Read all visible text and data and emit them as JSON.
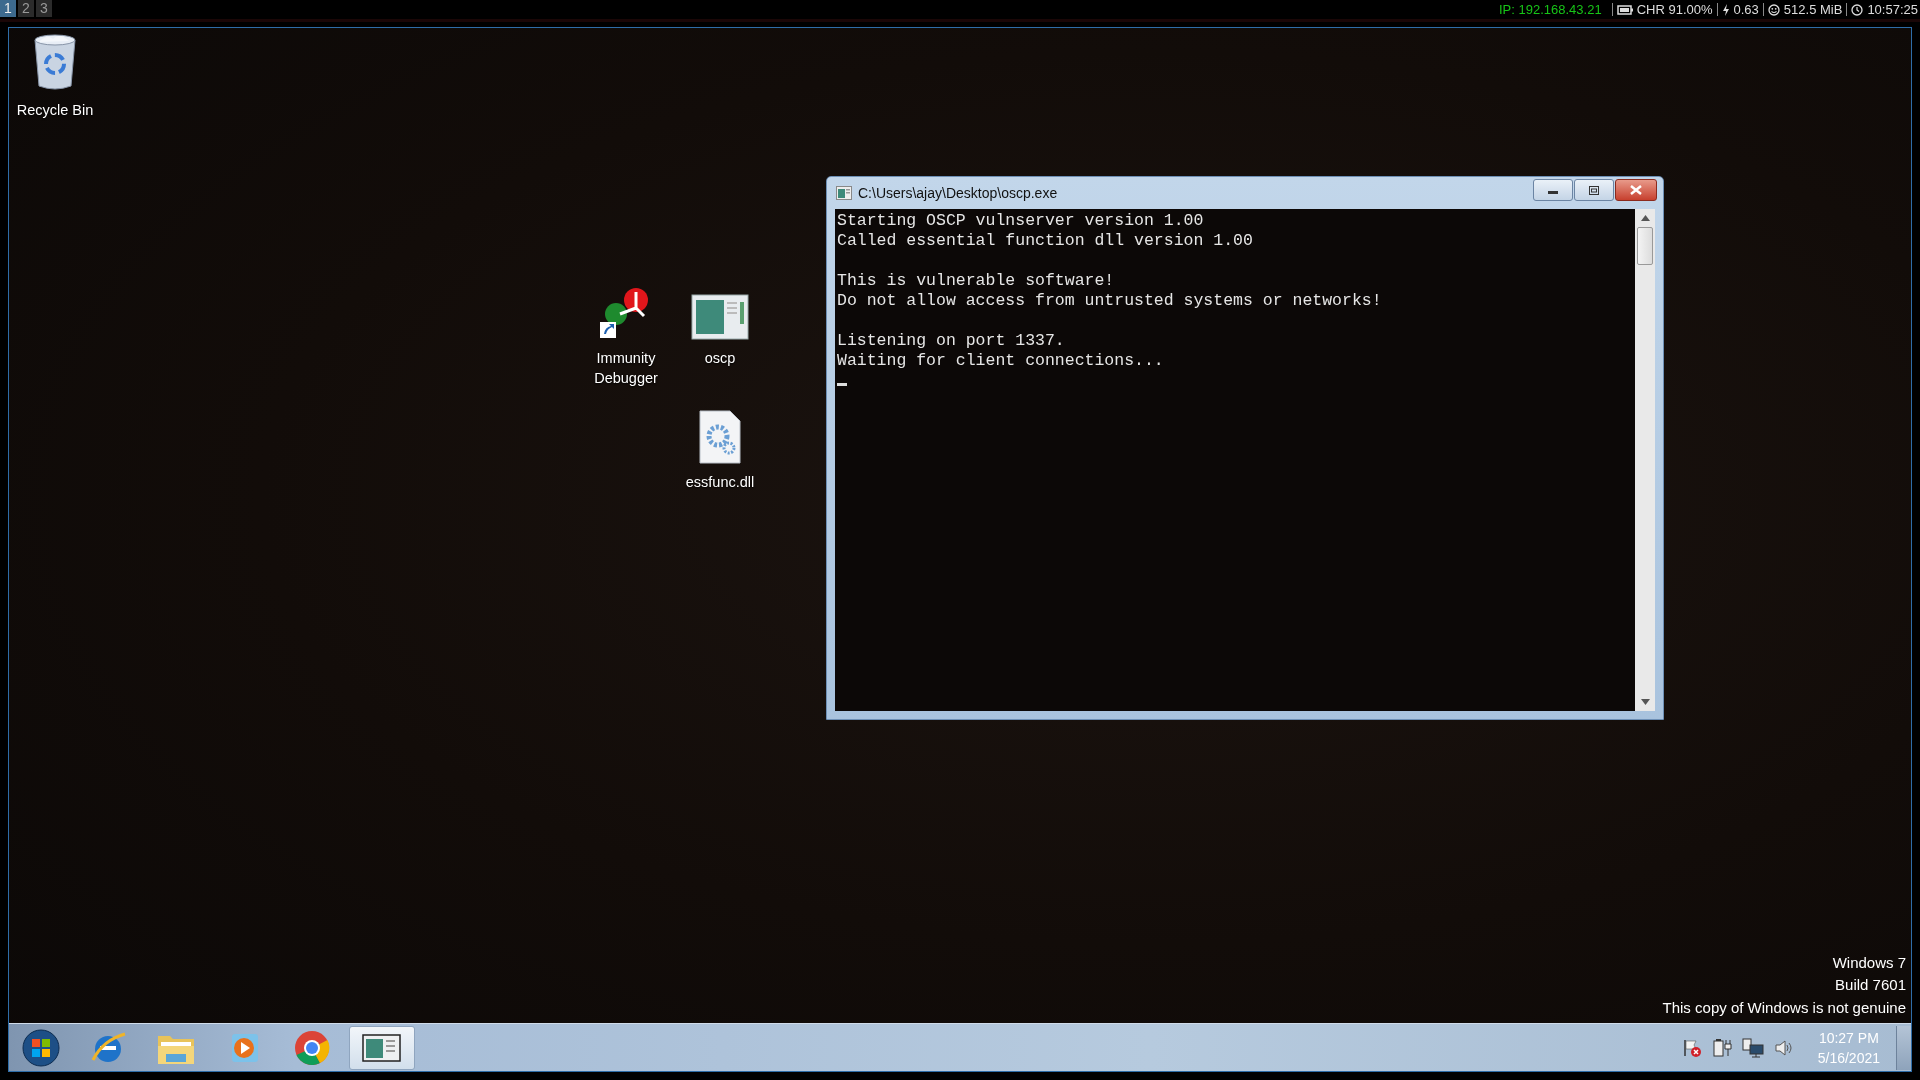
{
  "top_bar": {
    "workspaces": [
      {
        "label": "1",
        "selected": true
      },
      {
        "label": "2",
        "selected": false
      },
      {
        "label": "3",
        "selected": false
      }
    ],
    "ip": "IP: 192.168.43.21",
    "battery": "CHR 91.00%",
    "load": "0.63",
    "memory": "512.5 MiB",
    "time": "10:57:25"
  },
  "desktop_icons": [
    {
      "kind": "recycle-bin",
      "label": "Recycle Bin"
    },
    {
      "kind": "debugger",
      "label": "Immunity Debugger"
    },
    {
      "kind": "console",
      "label": "oscp"
    },
    {
      "kind": "dll",
      "label": "essfunc.dll"
    }
  ],
  "console_window": {
    "title": "C:\\Users\\ajay\\Desktop\\oscp.exe",
    "paragraphs": [
      [
        "Starting OSCP vulnserver version 1.00",
        "Called essential function dll version 1.00"
      ],
      [
        "This is vulnerable software!",
        "Do not allow access from untrusted systems or networks!"
      ],
      [
        "Listening on port 1337.",
        "Waiting for client connections..."
      ]
    ]
  },
  "os_notice": [
    "Windows 7",
    "Build 7601",
    "This copy of Windows is not genuine"
  ],
  "taskbar": {
    "buttons": [
      {
        "kind": "start",
        "selected": false
      },
      {
        "kind": "browser-e",
        "selected": false
      },
      {
        "kind": "folder",
        "selected": false
      },
      {
        "kind": "media",
        "selected": false
      },
      {
        "kind": "chrome",
        "selected": false
      },
      {
        "kind": "console",
        "selected": true
      }
    ],
    "clock": {
      "time": "10:27 PM",
      "date": "5/16/2021"
    }
  }
}
